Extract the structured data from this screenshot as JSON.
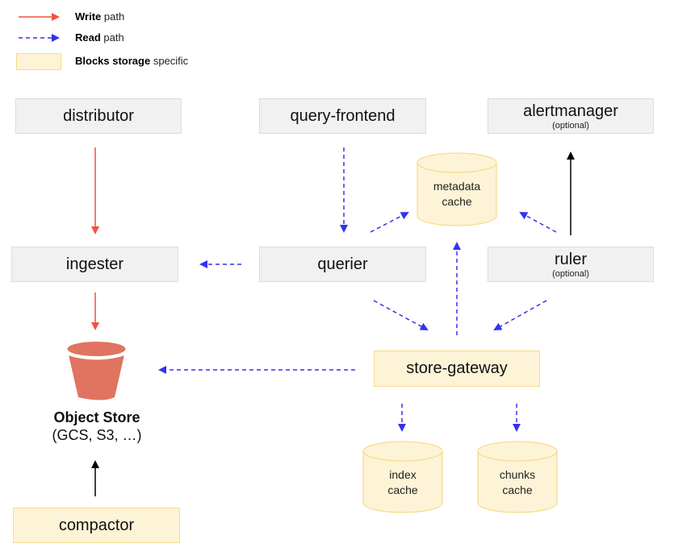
{
  "legend": {
    "write": {
      "bold": "Write",
      "rest": " path",
      "color": "#f0513f"
    },
    "read": {
      "bold": "Read",
      "rest": " path",
      "color": "#3232f0"
    },
    "blocks": {
      "bold": "Blocks storage",
      "rest": " specific",
      "fill": "#fdf3d6",
      "border": "#f6dc8c"
    }
  },
  "components": {
    "distributor": {
      "label": "distributor"
    },
    "query_frontend": {
      "label": "query-frontend"
    },
    "alertmanager": {
      "label": "alertmanager",
      "sub": "(optional)"
    },
    "ingester": {
      "label": "ingester"
    },
    "querier": {
      "label": "querier"
    },
    "ruler": {
      "label": "ruler",
      "sub": "(optional)"
    },
    "store_gateway": {
      "label": "store-gateway"
    },
    "compactor": {
      "label": "compactor"
    }
  },
  "caches": {
    "metadata": {
      "line1": "metadata",
      "line2": "cache"
    },
    "index": {
      "line1": "index",
      "line2": "cache"
    },
    "chunks": {
      "line1": "chunks",
      "line2": "cache"
    }
  },
  "object_store": {
    "title": "Object Store",
    "subtitle": "(GCS, S3, …)",
    "color": "#e07460"
  },
  "edges": [
    {
      "from": "distributor",
      "to": "ingester",
      "type": "write"
    },
    {
      "from": "ingester",
      "to": "object_store",
      "type": "write"
    },
    {
      "from": "query-frontend",
      "to": "querier",
      "type": "read"
    },
    {
      "from": "querier",
      "to": "ingester",
      "type": "read"
    },
    {
      "from": "querier",
      "to": "metadata cache",
      "type": "read"
    },
    {
      "from": "querier",
      "to": "store-gateway",
      "type": "read"
    },
    {
      "from": "ruler",
      "to": "metadata cache",
      "type": "read"
    },
    {
      "from": "ruler",
      "to": "store-gateway",
      "type": "read"
    },
    {
      "from": "ruler",
      "to": "alertmanager",
      "type": "other"
    },
    {
      "from": "store-gateway",
      "to": "metadata cache",
      "type": "read"
    },
    {
      "from": "store-gateway",
      "to": "object_store",
      "type": "read"
    },
    {
      "from": "store-gateway",
      "to": "index cache",
      "type": "read"
    },
    {
      "from": "store-gateway",
      "to": "chunks cache",
      "type": "read"
    },
    {
      "from": "compactor",
      "to": "object_store",
      "type": "other"
    }
  ]
}
